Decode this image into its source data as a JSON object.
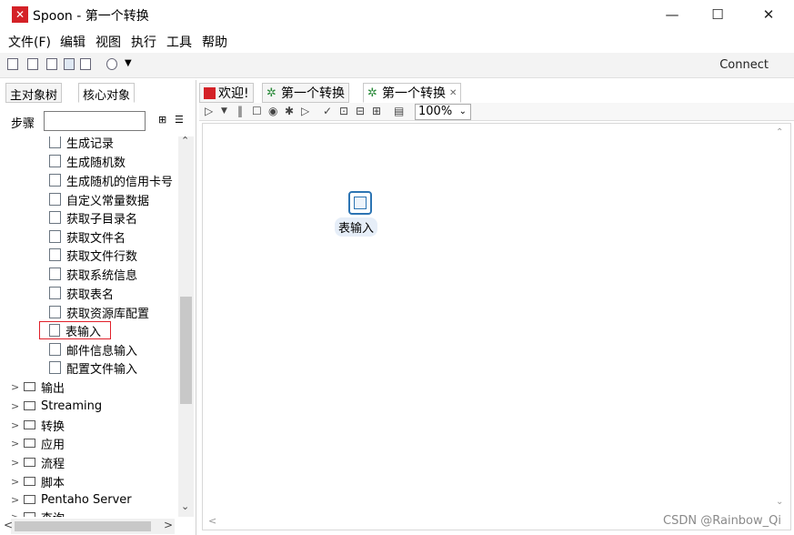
{
  "window": {
    "title": "Spoon - 第一个转换",
    "logo": "spoon-logo",
    "controls": [
      "—",
      "☐",
      "✕"
    ]
  },
  "menu": [
    "文件(F)",
    "编辑",
    "视图",
    "执行",
    "工具",
    "帮助"
  ],
  "toolbar": {
    "connect_label": "Connect"
  },
  "left_panel": {
    "tabs": [
      "主对象树",
      "核心对象"
    ],
    "steps_label": "步骤",
    "search_placeholder": "",
    "tree_items": [
      "生成记录",
      "生成随机数",
      "生成随机的信用卡号",
      "自定义常量数据",
      "获取子目录名",
      "获取文件名",
      "获取文件行数",
      "获取系统信息",
      "获取表名",
      "获取资源库配置",
      "表输入",
      "邮件信息输入",
      "配置文件输入"
    ],
    "folders": [
      "输出",
      "Streaming",
      "转换",
      "应用",
      "流程",
      "脚本",
      "Pentaho Server",
      "查询"
    ],
    "selected_item": "表输入"
  },
  "right_panel": {
    "tabs": [
      "欢迎!",
      "第一个转换",
      "第一个转换"
    ],
    "zoom": "100%",
    "step_label": "表输入"
  },
  "watermark": "CSDN @Rainbow_Qi",
  "colors": {
    "selection_border": "#e0202a",
    "step_border": "#2c74b3",
    "brand_red": "#d42127"
  }
}
